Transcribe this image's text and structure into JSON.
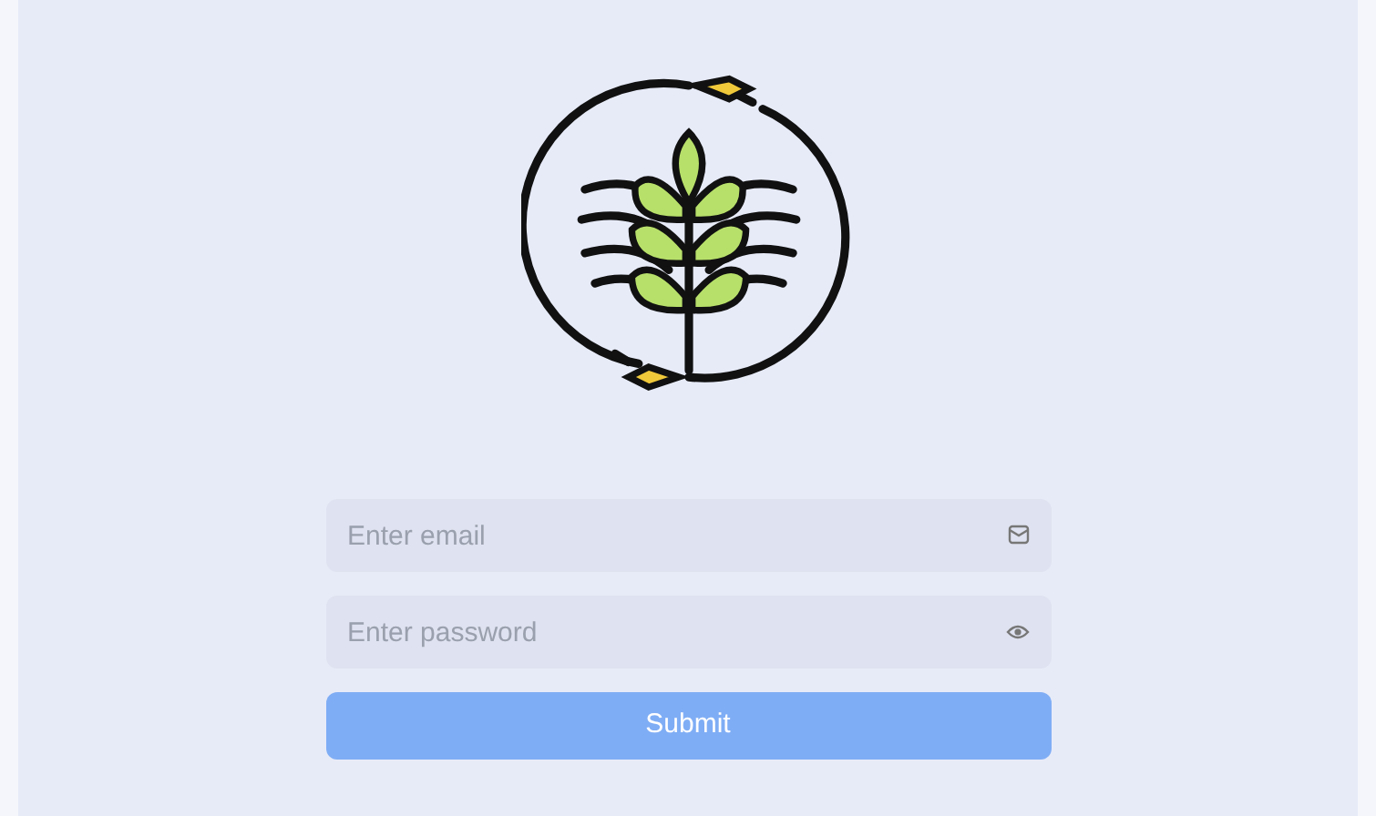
{
  "form": {
    "email": {
      "placeholder": "Enter email"
    },
    "password": {
      "placeholder": "Enter password"
    },
    "submit": {
      "label": "Submit"
    }
  }
}
